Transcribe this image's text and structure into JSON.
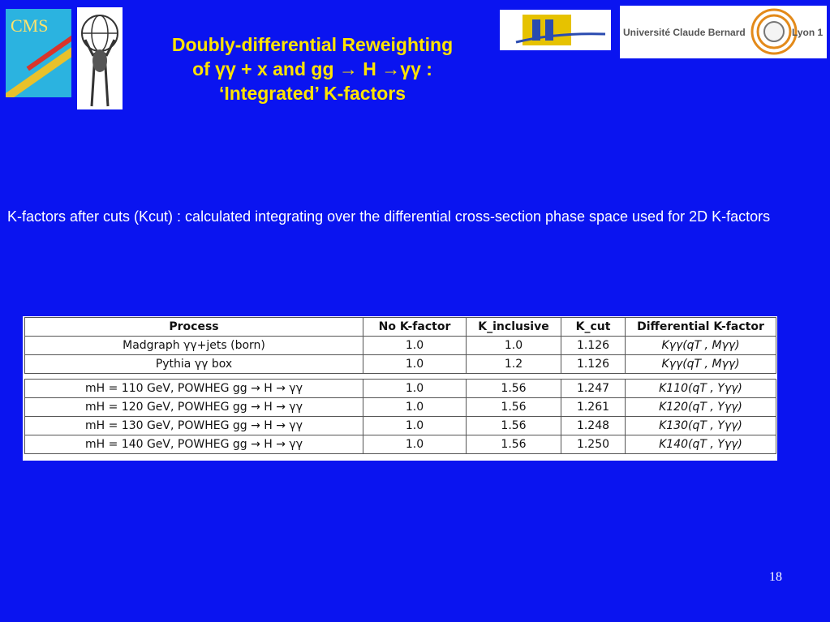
{
  "header": {
    "title_line1": "Doubly-differential Reweighting",
    "title_line2": "of γγ + x and  gg → H →γγ :",
    "title_line3": "‘Integrated’ K-factors"
  },
  "logos": {
    "cms": "CMS",
    "lyon_left": "Université Claude Bernard",
    "lyon_right": "Lyon 1"
  },
  "body": {
    "text": "K-factors after cuts (Kcut) : calculated integrating over the differential cross-section phase space used for 2D K-factors"
  },
  "table": {
    "headers": [
      "Process",
      "No K-factor",
      "K_inclusive",
      "K_cut",
      "Differential K-factor"
    ],
    "rows": [
      [
        "Madgraph γγ+jets (born)",
        "1.0",
        "1.0",
        "1.126",
        "Kγγ(qT , Mγγ)"
      ],
      [
        "Pythia γγ box",
        "1.0",
        "1.2",
        "1.126",
        "Kγγ(qT , Mγγ)"
      ],
      [
        "mH = 110 GeV, POWHEG gg → H → γγ",
        "1.0",
        "1.56",
        "1.247",
        "K110(qT , Yγγ)"
      ],
      [
        "mH = 120 GeV, POWHEG gg → H → γγ",
        "1.0",
        "1.56",
        "1.261",
        "K120(qT , Yγγ)"
      ],
      [
        "mH = 130 GeV, POWHEG gg → H → γγ",
        "1.0",
        "1.56",
        "1.248",
        "K130(qT , Yγγ)"
      ],
      [
        "mH = 140 GeV, POWHEG gg → H → γγ",
        "1.0",
        "1.56",
        "1.250",
        "K140(qT , Yγγ)"
      ]
    ]
  },
  "footer": {
    "page_number": "18"
  }
}
